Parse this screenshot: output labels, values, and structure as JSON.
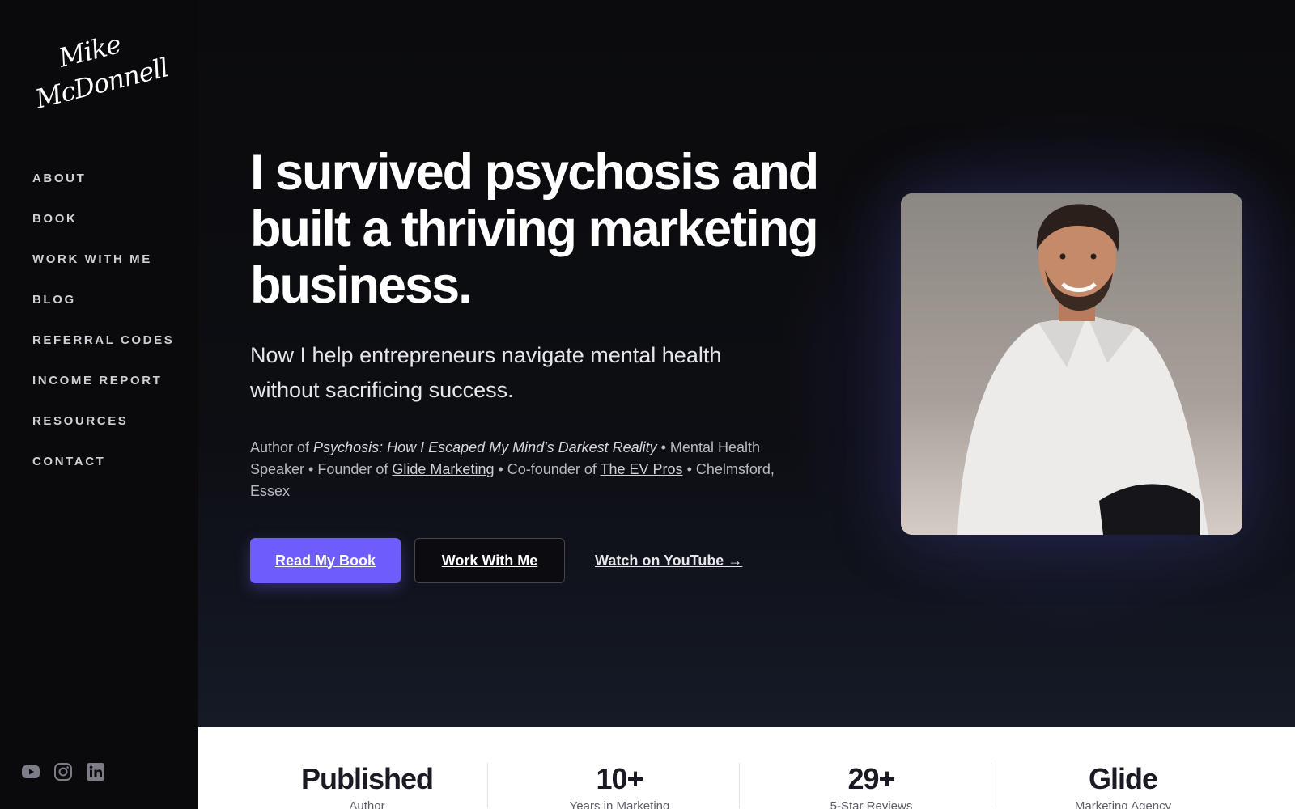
{
  "logo": {
    "line1": "Mike",
    "line2": "McDonnell"
  },
  "nav": [
    {
      "label": "ABOUT"
    },
    {
      "label": "BOOK"
    },
    {
      "label": "WORK WITH ME"
    },
    {
      "label": "BLOG"
    },
    {
      "label": "REFERRAL CODES"
    },
    {
      "label": "INCOME REPORT"
    },
    {
      "label": "RESOURCES"
    },
    {
      "label": "CONTACT"
    }
  ],
  "socials": [
    "youtube-icon",
    "instagram-icon",
    "linkedin-icon"
  ],
  "hero": {
    "headline": "I survived psychosis and built a thriving marketing business.",
    "subhead": "Now I help entrepreneurs navigate mental health without sacrificing success.",
    "bio": {
      "author_prefix": "Author of ",
      "book_title": "Psychosis: How I Escaped My Mind's Darkest Reality",
      "mid1": " • Mental Health Speaker • Founder of ",
      "link1": "Glide Marketing",
      "mid2": " • Co-founder of ",
      "link2": "The EV Pros",
      "suffix": " • Chelmsford, Essex"
    },
    "buttons": {
      "primary": "Read My Book",
      "secondary": "Work With Me",
      "link": "Watch on YouTube →"
    }
  },
  "stats": [
    {
      "value": "Published",
      "label": "Author"
    },
    {
      "value": "10+",
      "label": "Years in Marketing"
    },
    {
      "value": "29+",
      "label": "5-Star Reviews"
    },
    {
      "value": "Glide",
      "label": "Marketing Agency"
    }
  ],
  "colors": {
    "accent": "#6d5dfc",
    "background": "#0b0b0d",
    "stats_background": "#ffffff"
  }
}
